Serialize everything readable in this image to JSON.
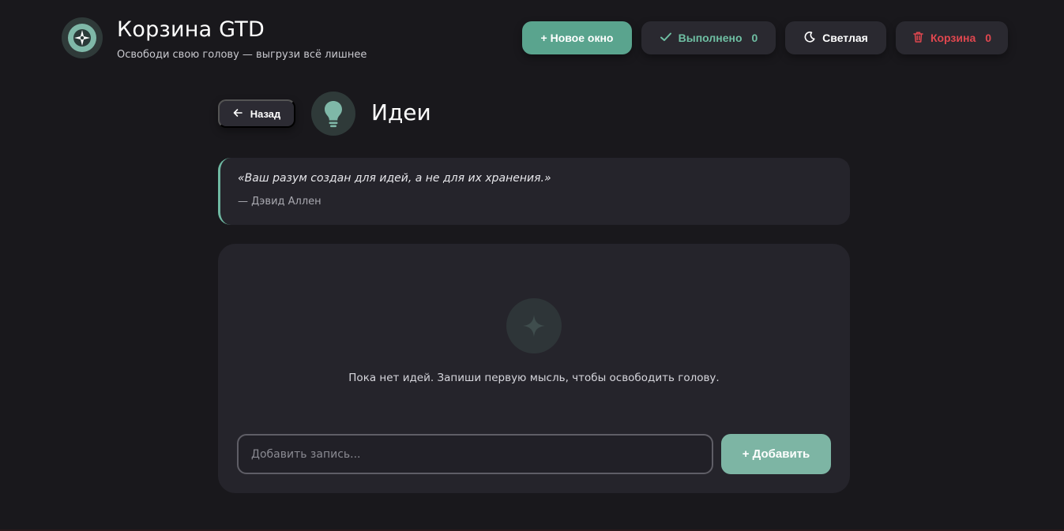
{
  "header": {
    "title": "Корзина GTD",
    "subtitle": "Освободи свою голову — выгрузи всё лишнее",
    "logo_icon": "compass-star-icon"
  },
  "actions": {
    "new_window": {
      "label": "+ Новое окно"
    },
    "done": {
      "label": "Выполнено",
      "count": "0",
      "icon": "check-icon"
    },
    "theme": {
      "label": "Светлая",
      "icon": "moon-icon"
    },
    "trash": {
      "label": "Корзина",
      "count": "0",
      "icon": "trash-icon"
    }
  },
  "section": {
    "back_label": "Назад",
    "title": "Идеи",
    "icon": "lightbulb-icon"
  },
  "quote": {
    "text": "«Ваш разум создан для идей, а не для их хранения.»",
    "author": "— Дэвид Аллен"
  },
  "main": {
    "empty_icon": "sparkle-icon",
    "empty_text": "Пока нет идей. Запиши первую мысль, чтобы освободить голову.",
    "input_placeholder": "Добавить запись...",
    "input_value": "",
    "add_label": "+ Добавить"
  },
  "colors": {
    "background": "#19181c",
    "card": "#25242b",
    "accent": "#5aa48e",
    "done": "#6fbfa3",
    "danger": "#e0474f"
  }
}
